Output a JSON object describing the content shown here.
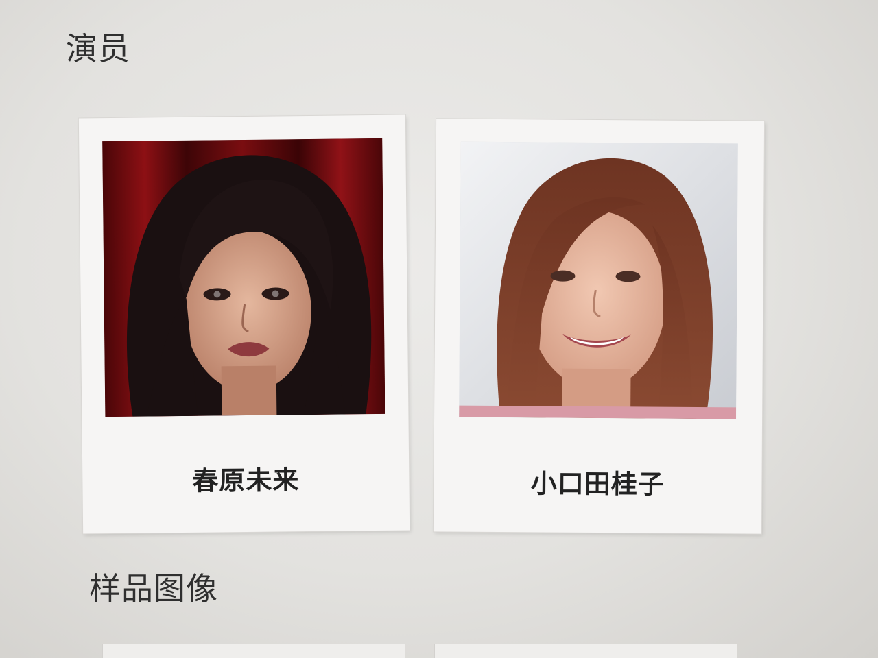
{
  "sections": {
    "actors_title": "演员",
    "samples_title": "样品图像"
  },
  "actors": [
    {
      "name": "春原未来",
      "photo": "actor-portrait-1"
    },
    {
      "name": "小口田桂子",
      "photo": "actor-portrait-2"
    }
  ]
}
